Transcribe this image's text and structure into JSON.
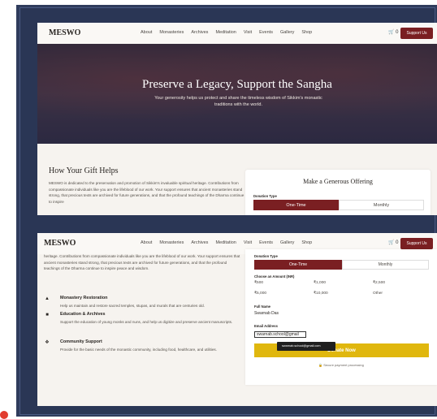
{
  "nav": {
    "brand": "MESWO",
    "items": [
      "About",
      "Monasteries",
      "Archives",
      "Meditation",
      "Visit",
      "Events",
      "Gallery",
      "Shop"
    ],
    "cart_count": "0",
    "support_label": "Support Us"
  },
  "hero": {
    "title": "Preserve a Legacy, Support the Sangha",
    "subtitle": "Your generosity helps us protect and share the timeless wisdom of Sikkim's monastic traditions with the world."
  },
  "gift": {
    "title": "How Your Gift Helps",
    "text": "MESWO is dedicated to the preservation and promotion of Sikkim's invaluable spiritual heritage. Contributions from compassionate individuals like you are the lifeblood of our work. Your support ensures that ancient monasteries stand strong, that precious texts are archived for future generations, and that the profound teachings of the Dharma continue to inspire",
    "text_cont": "heritage. Contributions from compassionate individuals like you are the lifeblood of our work. Your support ensures that ancient monasteries stand strong, that precious texts are archived for future generations, and that the profound teachings of the Dharma continue to inspire peace and wisdom.",
    "features": [
      {
        "title": "Monastery Restoration",
        "desc": "Help us maintain and restore sacred temples, stupas, and murals that are centuries old."
      },
      {
        "title": "Education & Archives",
        "desc": "Support the education of young monks and nuns, and help us digitize and preserve ancient manuscripts."
      },
      {
        "title": "Community Support",
        "desc": "Provide for the basic needs of the monastic community, including food, healthcare, and utilities."
      }
    ]
  },
  "form": {
    "title": "Make a Generous Offering",
    "donation_type_label": "Donation Type",
    "one_time": "One-Time",
    "monthly": "Monthly",
    "amount_label": "Choose an Amount (INR)",
    "amounts": [
      "₹500",
      "₹1,000",
      "₹2,500",
      "₹5,000",
      "₹10,000",
      "Other"
    ],
    "full_name_label": "Full Name",
    "full_name_value": "Swarnab Das",
    "email_label": "Email Address",
    "email_value": "swarnab.school@gmail",
    "autocomplete_suggestion": "swarnab.school@gmail.com",
    "donate_label": "Donate Now",
    "secure_note": "Secure payment processing"
  }
}
